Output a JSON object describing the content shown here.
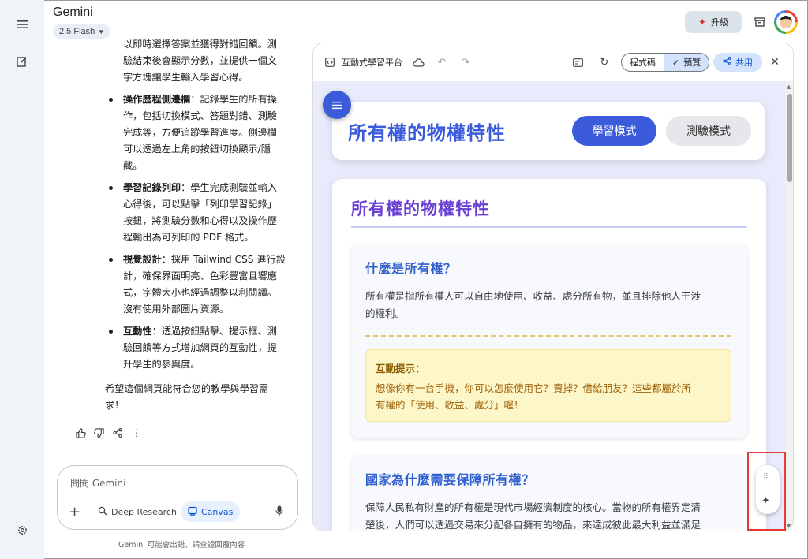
{
  "app": {
    "title": "Gemini",
    "model": "2.5 Flash"
  },
  "header": {
    "upgrade_label": "升級"
  },
  "icons": {
    "menu": "menu-icon",
    "new_chat": "edit-icon",
    "settings": "gear-icon",
    "upgrade": "sparkle-icon",
    "archive": "archive-icon"
  },
  "chat": {
    "intro_lines": [
      "以即時選擇答案並獲得對錯回饋。測",
      "驗結束後會顯示分數，並提供一個文",
      "字方塊讓學生輸入學習心得。"
    ],
    "bullets": [
      {
        "bold": "操作歷程側邊欄",
        "lines": [
          "：記錄學生的所有操",
          "作，包括切換模式、答題對錯、測驗",
          "完成等，方便追蹤學習進度。側邊欄",
          "可以透過左上角的按鈕切換顯示/隱",
          "藏。"
        ]
      },
      {
        "bold": "學習記錄列印",
        "lines": [
          "：學生完成測驗並輸入",
          "心得後，可以點擊「列印學習記錄」",
          "按鈕，將測驗分數和心得以及操作歷",
          "程輸出為可列印的 PDF 格式。"
        ]
      },
      {
        "bold": "視覺設計",
        "lines": [
          "：採用 Tailwind CSS 進行設",
          "計，確保界面明亮、色彩豐富且響應",
          "式，字體大小也經過調整以利閱讀。",
          "沒有使用外部圖片資源。"
        ]
      },
      {
        "bold": "互動性",
        "lines": [
          "：透過按鈕點擊、提示框、測",
          "驗回饋等方式增加網頁的互動性，提",
          "升學生的參與度。"
        ]
      }
    ],
    "closing_lines": [
      "希望這個網頁能符合您的教學與學習需",
      "求！"
    ]
  },
  "input": {
    "placeholder": "問問 Gemini",
    "deep_research": "Deep Research",
    "canvas": "Canvas",
    "disclaimer": "Gemini 可能會出錯，請查證回覆內容"
  },
  "panel": {
    "title": "互動式學習平台",
    "code_label": "程式碼",
    "preview_label": "預覽",
    "share_label": "共用"
  },
  "page": {
    "header_title": "所有權的物權特性",
    "study_mode": "學習模式",
    "quiz_mode": "測驗模式",
    "content_title": "所有權的物權特性",
    "section1": {
      "heading": "什麼是所有權？",
      "body_lines": [
        "所有權是指所有權人可以自由地使用、收益、處分所有物，並且排除他人干涉",
        "的權利。"
      ],
      "tip_heading": "互動提示：",
      "tip_lines": [
        "想像你有一台手機，你可以怎麼使用它？賣掉？借給朋友？這些都屬於所",
        "有權的「使用、收益、處分」喔！"
      ]
    },
    "section2": {
      "heading": "國家為什麼需要保障所有權？",
      "body_lines": [
        "保障人民私有財產的所有權是現代市場經濟制度的核心。當物的所有權界定清",
        "楚後，人們可以透過交易來分配各自擁有的物品，來達成彼此最大利益並滿足"
      ]
    }
  }
}
